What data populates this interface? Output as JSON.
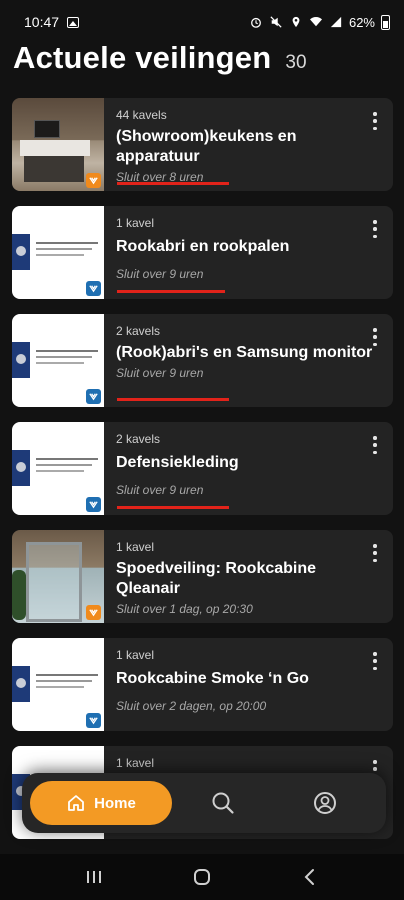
{
  "status_bar": {
    "time": "10:47",
    "battery": "62%"
  },
  "header": {
    "title": "Actuele veilingen",
    "count": "30"
  },
  "auctions": [
    {
      "kavels": "44 kavels",
      "title": "(Showroom)keukens en apparatuur",
      "closes": "Sluit over 8 uren",
      "thumb": "kitchen-photo",
      "badge_color": "#f08a1c",
      "closing_soon": true
    },
    {
      "kavels": "1 kavel",
      "title": "Rookabri en rookpalen",
      "closes": "Sluit over 9 uren",
      "thumb": "domeinen-logo",
      "badge_color": "#1f6fb2",
      "closing_soon": true
    },
    {
      "kavels": "2 kavels",
      "title": "(Rook)abri's en Samsung monitor",
      "closes": "Sluit over 9 uren",
      "thumb": "domeinen-logo",
      "badge_color": "#1f6fb2",
      "closing_soon": true
    },
    {
      "kavels": "2 kavels",
      "title": "Defensiekleding",
      "closes": "Sluit over 9 uren",
      "thumb": "domeinen-logo",
      "badge_color": "#1f6fb2",
      "closing_soon": true
    },
    {
      "kavels": "1 kavel",
      "title": "Spoedveiling: Rookcabine Qleanair",
      "closes": "Sluit over 1 dag, op 20:30",
      "thumb": "cabin-photo",
      "badge_color": "#f08a1c",
      "closing_soon": false
    },
    {
      "kavels": "1 kavel",
      "title": "Rookcabine Smoke ‘n Go",
      "closes": "Sluit over 2 dagen, op 20:00",
      "thumb": "domeinen-logo",
      "badge_color": "#1f6fb2",
      "closing_soon": false
    },
    {
      "kavels": "1 kavel",
      "title": "",
      "closes": "",
      "thumb": "domeinen-logo",
      "badge_color": "#1f6fb2",
      "closing_soon": false
    }
  ],
  "bottom_nav": {
    "home_label": "Home",
    "home_icon": "home-icon",
    "search_icon": "search-icon",
    "account_icon": "account-icon"
  },
  "colors": {
    "accent": "#f39a24",
    "urgent_underline": "#e2231a",
    "card_bg": "#232323",
    "page_bg": "#121212"
  }
}
